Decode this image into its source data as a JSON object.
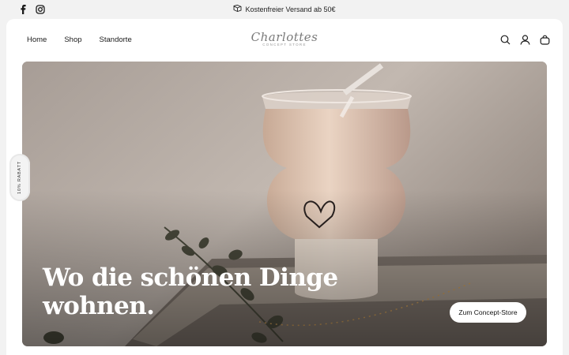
{
  "announcement": {
    "message": "Kostenfreier Versand ab 50€",
    "social": [
      {
        "icon": "facebook-icon"
      },
      {
        "icon": "instagram-icon"
      }
    ]
  },
  "header": {
    "nav": [
      "Home",
      "Shop",
      "Standorte"
    ],
    "logo": {
      "name": "Charlottes",
      "tagline": "CONCEPT STORE"
    },
    "icons": [
      "search-icon",
      "account-icon",
      "cart-icon"
    ]
  },
  "hero": {
    "title": "Wo die schönen Dinge wohnen.",
    "button": "Zum Concept-Store"
  },
  "discount_tab": {
    "label": "10% RABATT"
  },
  "colors": {
    "background": "#f2f2f2",
    "surface": "#ffffff",
    "text": "#1a1a1a",
    "button_bg": "#ffffff"
  }
}
